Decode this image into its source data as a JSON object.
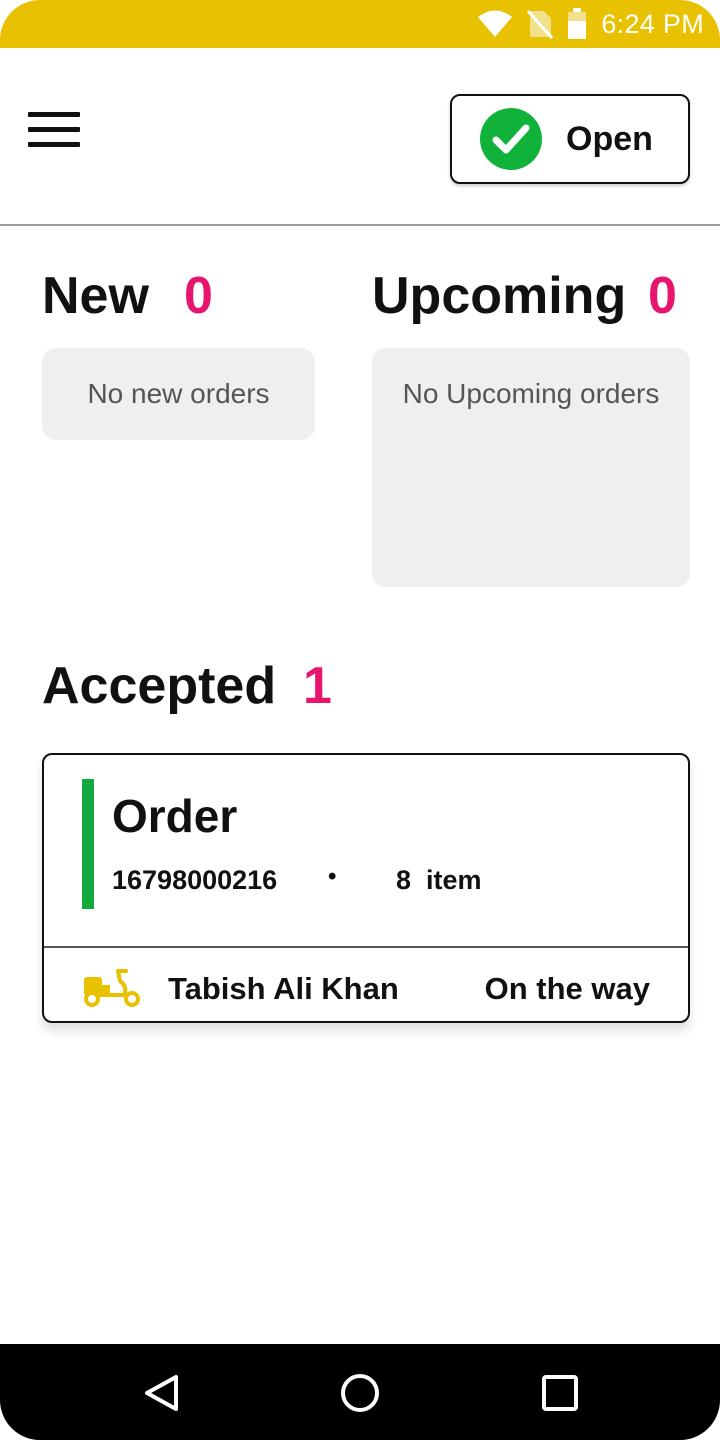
{
  "status_bar": {
    "time": "6:24 PM",
    "icons": [
      "wifi-icon",
      "no-sim-icon",
      "battery-icon"
    ],
    "color": "#e8c100"
  },
  "header": {
    "menu_icon": "hamburger-menu-icon",
    "store_status_label": "Open",
    "store_status_icon": "check-circle-icon",
    "store_status_color": "#11b23a"
  },
  "new_orders": {
    "title": "New",
    "count": "0",
    "empty_text": "No new orders"
  },
  "upcoming_orders": {
    "title": "Upcoming",
    "count": "0",
    "empty_text": "No Upcoming orders"
  },
  "accepted_orders": {
    "title": "Accepted",
    "count": "1",
    "orders": [
      {
        "title": "Order",
        "number": "16798000216",
        "separator": "•",
        "item_count": "8",
        "item_label": "item",
        "rider_icon": "scooter-icon",
        "rider_name": "Tabish Ali Khan",
        "status": "On the way"
      }
    ]
  },
  "count_color": "#e8156f",
  "nav_bar": {
    "buttons": [
      "back-icon",
      "home-icon",
      "recents-icon"
    ]
  }
}
